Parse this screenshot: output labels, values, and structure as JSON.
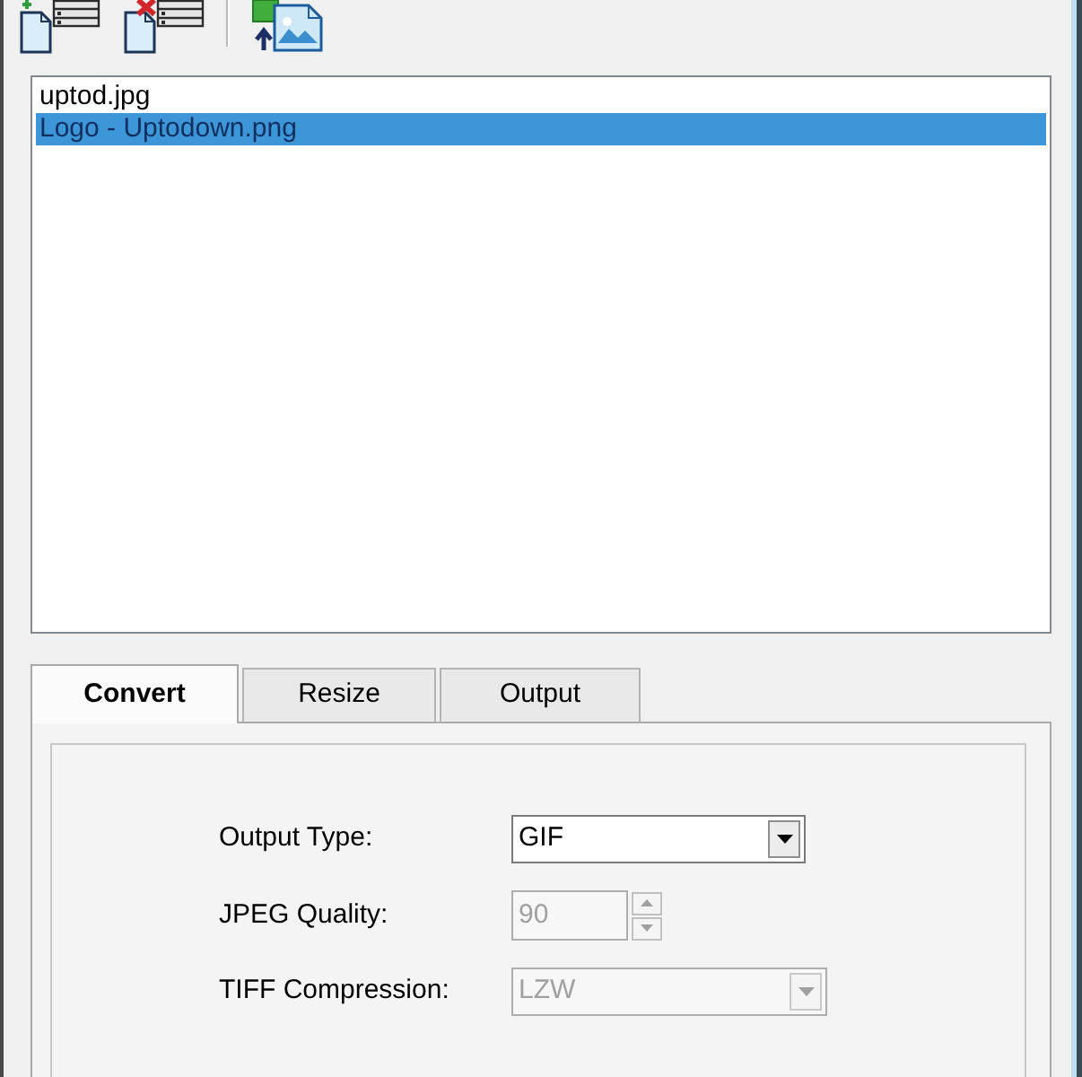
{
  "files": [
    {
      "name": "uptod.jpg",
      "selected": false
    },
    {
      "name": "Logo - Uptodown.png",
      "selected": true
    }
  ],
  "tabs": [
    {
      "label": "Convert",
      "selected": true
    },
    {
      "label": "Resize",
      "selected": false
    },
    {
      "label": "Output",
      "selected": false
    }
  ],
  "convert_tab": {
    "fields": [
      {
        "kind": "dropdown",
        "label": "Output Type:",
        "value": "GIF",
        "disabled": false
      },
      {
        "kind": "spinner",
        "label": "JPEG Quality:",
        "value": "90",
        "disabled": true
      },
      {
        "kind": "dropdown",
        "label": "TIFF Compression:",
        "value": "LZW",
        "disabled": true
      }
    ]
  }
}
